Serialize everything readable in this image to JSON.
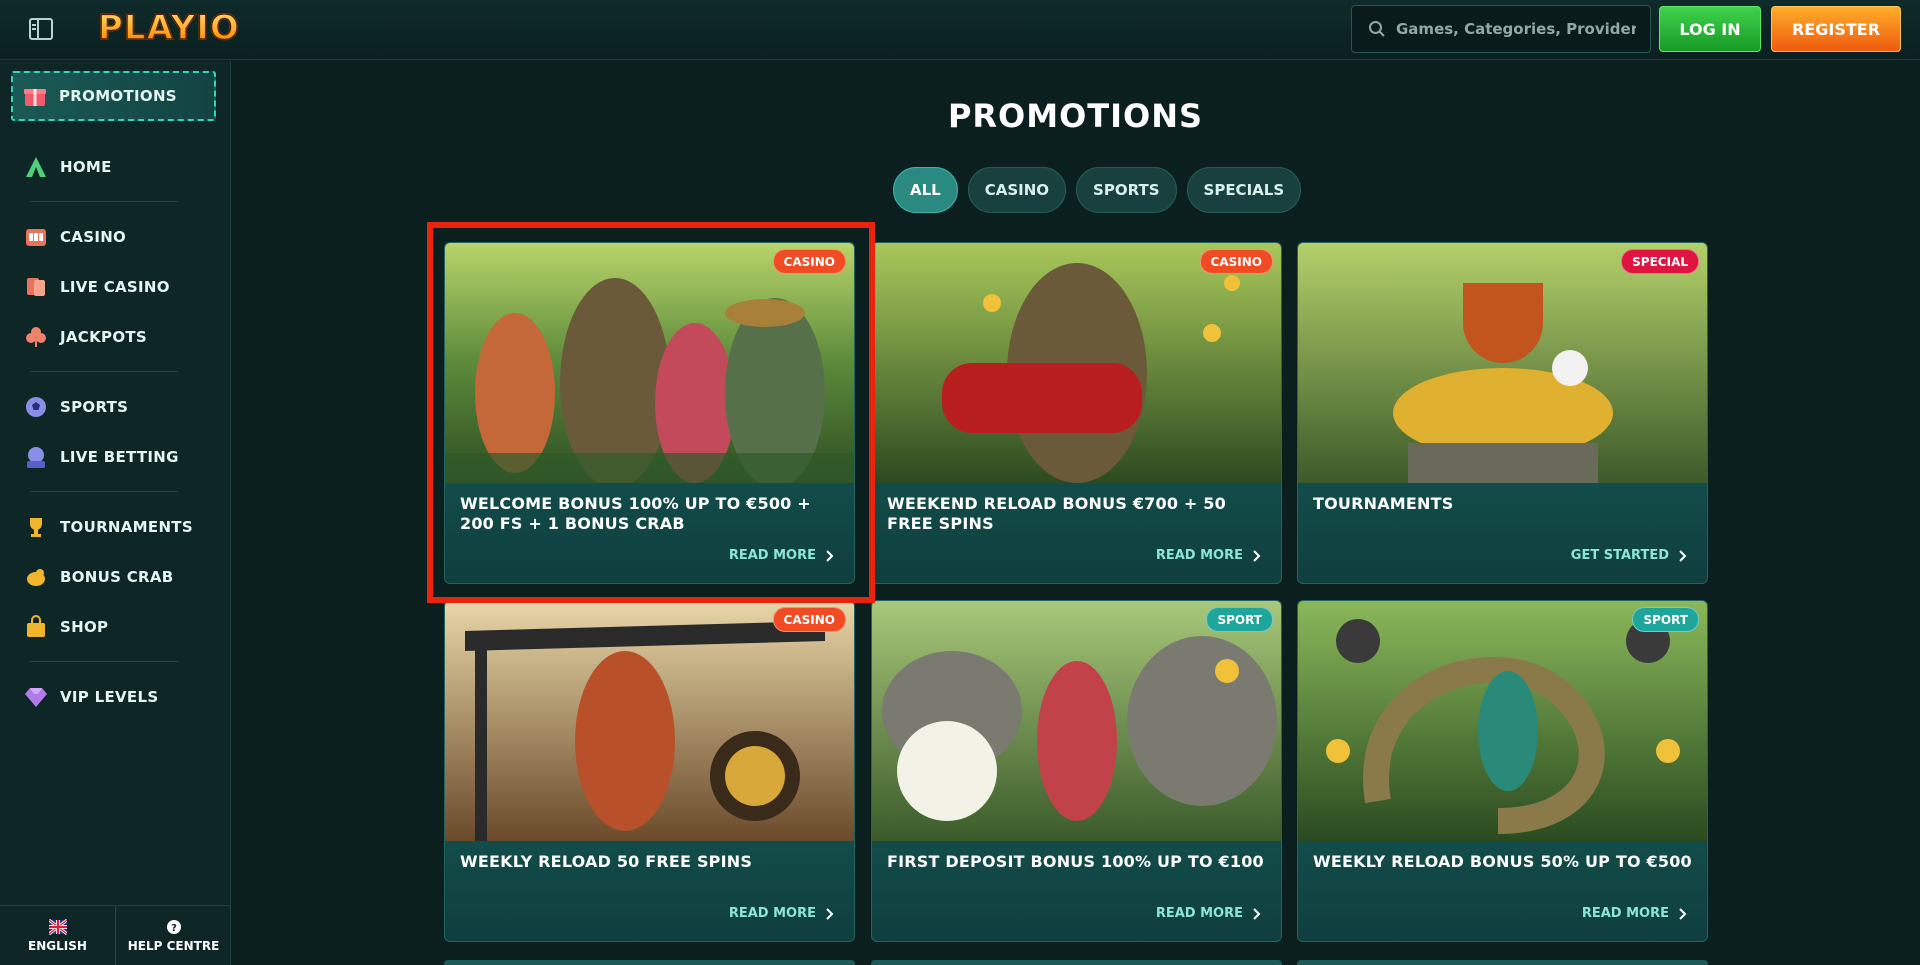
{
  "header": {
    "logo_text": "PLAYIO",
    "search_placeholder": "Games, Categories, Providers",
    "login_label": "LOG IN",
    "register_label": "REGISTER"
  },
  "sidebar": {
    "items": [
      {
        "label": "PROMOTIONS",
        "icon": "gift-icon",
        "active": true
      },
      {
        "label": "HOME",
        "icon": "tent-icon"
      },
      {
        "label": "CASINO",
        "icon": "slot-machine-icon"
      },
      {
        "label": "LIVE CASINO",
        "icon": "cards-icon"
      },
      {
        "label": "JACKPOTS",
        "icon": "clover-icon"
      },
      {
        "label": "SPORTS",
        "icon": "football-icon"
      },
      {
        "label": "LIVE BETTING",
        "icon": "live-icon"
      },
      {
        "label": "TOURNAMENTS",
        "icon": "trophy-icon"
      },
      {
        "label": "BONUS CRAB",
        "icon": "crab-icon"
      },
      {
        "label": "SHOP",
        "icon": "shopping-bag-icon"
      },
      {
        "label": "VIP LEVELS",
        "icon": "diamond-icon"
      }
    ],
    "footer": {
      "language": "ENGLISH",
      "help": "HELP CENTRE"
    }
  },
  "main": {
    "title": "PROMOTIONS",
    "filters": [
      "ALL",
      "CASINO",
      "SPORTS",
      "SPECIALS"
    ],
    "active_filter": "ALL",
    "cards": [
      {
        "badge": "CASINO",
        "title": "WELCOME BONUS 100% UP TO €500 + 200 FS + 1 BONUS CRAB",
        "cta": "READ MORE"
      },
      {
        "badge": "CASINO",
        "title": "WEEKEND RELOAD BONUS €700 + 50 FREE SPINS",
        "cta": "READ MORE"
      },
      {
        "badge": "SPECIAL",
        "title": "TOURNAMENTS",
        "cta": "GET STARTED"
      },
      {
        "badge": "CASINO",
        "title": "WEEKLY RELOAD 50 FREE SPINS",
        "cta": "READ MORE"
      },
      {
        "badge": "SPORT",
        "title": "FIRST DEPOSIT BONUS 100% UP TO €100",
        "cta": "READ MORE"
      },
      {
        "badge": "SPORT",
        "title": "WEEKLY RELOAD BONUS 50% UP TO €500",
        "cta": "READ MORE"
      }
    ]
  },
  "colors": {
    "background": "#0c1f1f",
    "accent_teal": "#2a8a82",
    "login_green": "#3fd24b",
    "register_orange": "#f05a0f",
    "highlight_red": "#e8230e"
  }
}
